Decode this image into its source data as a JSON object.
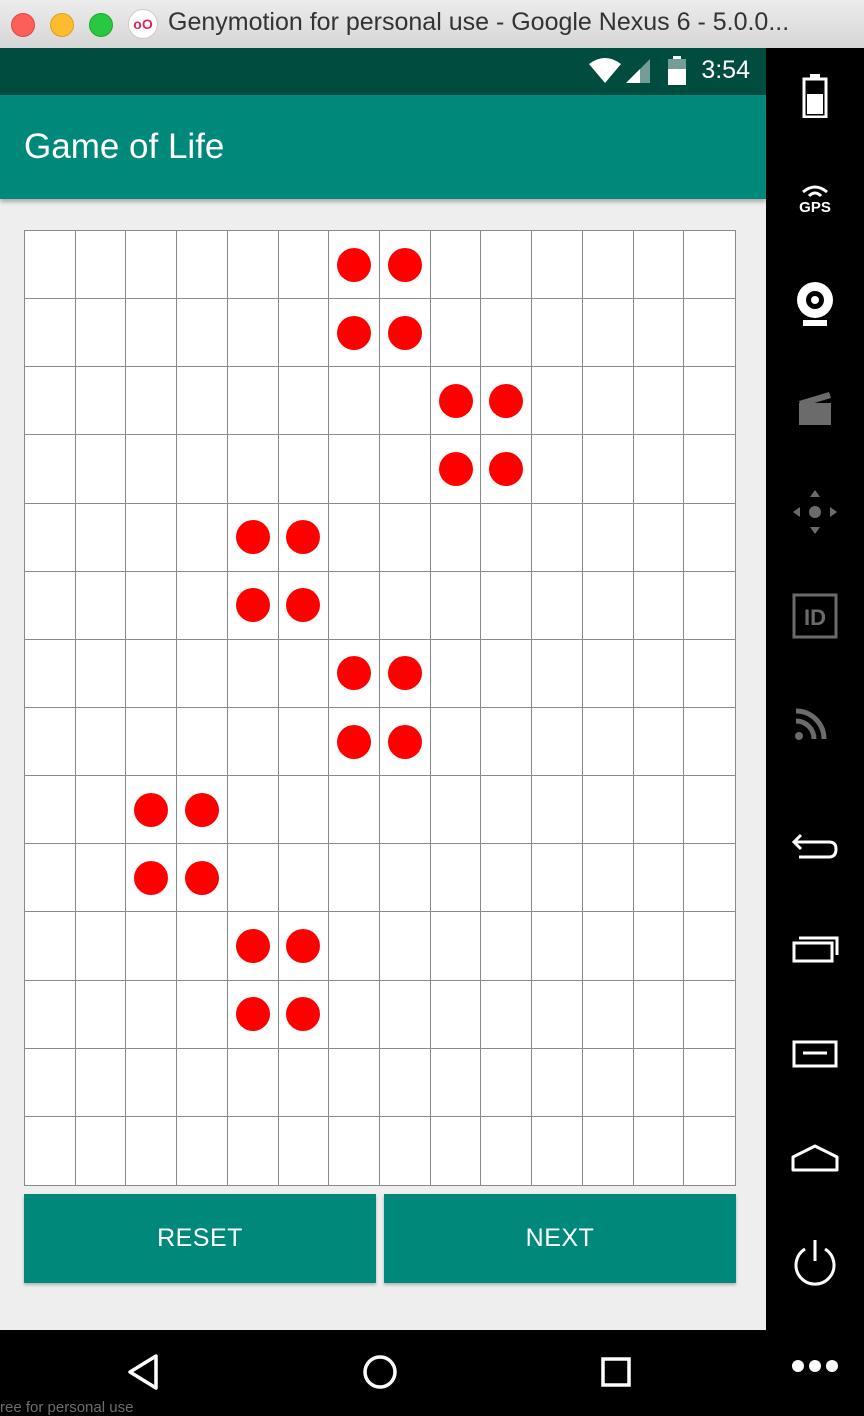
{
  "window": {
    "title": "Genymotion for personal use - Google Nexus 6 - 5.0.0...",
    "logo_text": "oO"
  },
  "statusbar": {
    "time": "3:54"
  },
  "appbar": {
    "title": "Game of Life"
  },
  "board": {
    "rows": 14,
    "cols": 14,
    "alive_color": "#ff0000",
    "alive_cells": [
      [
        0,
        6
      ],
      [
        0,
        7
      ],
      [
        1,
        6
      ],
      [
        1,
        7
      ],
      [
        2,
        8
      ],
      [
        2,
        9
      ],
      [
        3,
        8
      ],
      [
        3,
        9
      ],
      [
        4,
        4
      ],
      [
        4,
        5
      ],
      [
        5,
        4
      ],
      [
        5,
        5
      ],
      [
        6,
        6
      ],
      [
        6,
        7
      ],
      [
        7,
        6
      ],
      [
        7,
        7
      ],
      [
        8,
        2
      ],
      [
        8,
        3
      ],
      [
        9,
        2
      ],
      [
        9,
        3
      ],
      [
        10,
        4
      ],
      [
        10,
        5
      ],
      [
        11,
        4
      ],
      [
        11,
        5
      ]
    ]
  },
  "buttons": {
    "reset": "RESET",
    "next": "NEXT"
  },
  "sidebar": {
    "gps": "GPS",
    "icons": [
      "battery-icon",
      "gps-icon",
      "webcam-icon",
      "clapper-icon",
      "dpad-icon",
      "id-icon",
      "cast-icon",
      "back-icon",
      "recent-apps-icon",
      "menu-icon",
      "home-icon",
      "power-icon",
      "more-icon"
    ]
  },
  "watermark": "ree for personal use",
  "colors": {
    "primary": "#00897b",
    "primary_dark": "#004d40",
    "alive": "#ff0000"
  }
}
